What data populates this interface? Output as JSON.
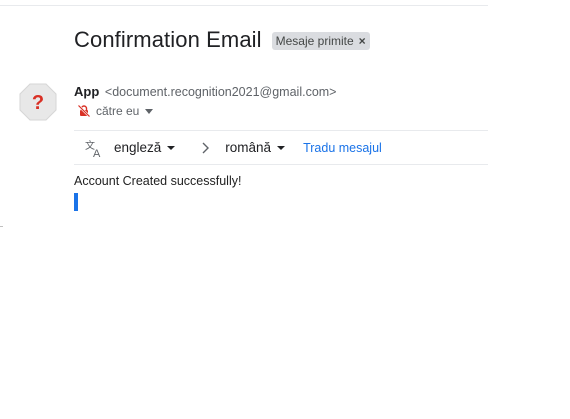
{
  "email": {
    "subject": "Confirmation Email",
    "label": "Mesaje primite",
    "label_remove_icon": "×",
    "sender_name": "App",
    "sender_email": "<document.recognition2021@gmail.com>",
    "recipient": "către eu",
    "avatar_icon": "question-mark-icon",
    "body": "Account Created successfully!"
  },
  "translate": {
    "icon": "translate-icon",
    "source_lang": "engleză",
    "target_lang": "română",
    "action": "Tradu mesajul"
  },
  "colors": {
    "avatar_red": "#d93025",
    "link_blue": "#1a73e8",
    "chip_gray": "#dadce0"
  }
}
